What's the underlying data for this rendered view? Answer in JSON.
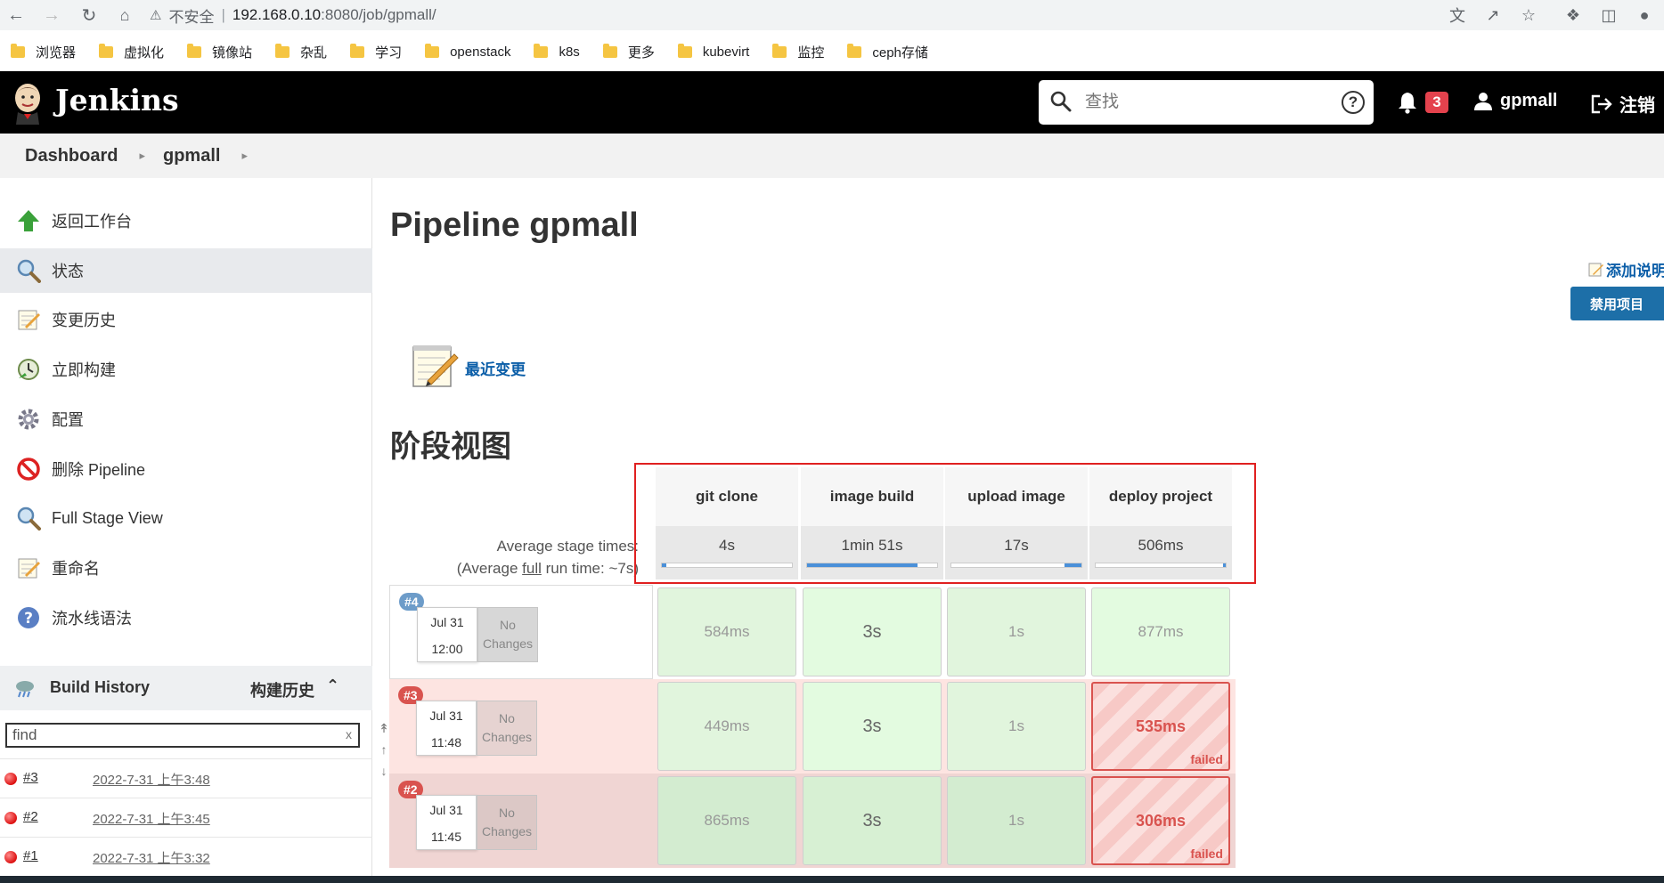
{
  "browser": {
    "insecure_label": "不安全",
    "separator": "|",
    "host": "192.168.0.10",
    "path": ":8080/job/gpmall/",
    "bookmarks": [
      "浏览器",
      "虚拟化",
      "镜像站",
      "杂乱",
      "学习",
      "openstack",
      "k8s",
      "更多",
      "kubevirt",
      "监控",
      "ceph存储"
    ]
  },
  "header": {
    "title": "Jenkins",
    "search_placeholder": "查找",
    "help": "?",
    "notifications": "3",
    "user": "gpmall",
    "logout": "注销"
  },
  "breadcrumb": {
    "items": [
      "Dashboard",
      "gpmall"
    ]
  },
  "sidebar": {
    "tasks": [
      {
        "label": "返回工作台",
        "icon": "up-arrow-icon"
      },
      {
        "label": "状态",
        "icon": "magnifier-icon"
      },
      {
        "label": "变更历史",
        "icon": "notepad-icon"
      },
      {
        "label": "立即构建",
        "icon": "build-clock-icon"
      },
      {
        "label": "配置",
        "icon": "gear-icon"
      },
      {
        "label": "删除 Pipeline",
        "icon": "no-entry-icon"
      },
      {
        "label": "Full Stage View",
        "icon": "magnifier-icon"
      },
      {
        "label": "重命名",
        "icon": "notepad-icon"
      },
      {
        "label": "流水线语法",
        "icon": "help-circle-icon"
      }
    ],
    "build_history": {
      "title": "Build History",
      "title_cn": "构建历史",
      "filter_placeholder": "find",
      "clear": "x",
      "builds": [
        {
          "number": "#3",
          "date": "2022-7-31 上午3:48"
        },
        {
          "number": "#2",
          "date": "2022-7-31 上午3:45"
        },
        {
          "number": "#1",
          "date": "2022-7-31 上午3:32"
        }
      ]
    }
  },
  "main": {
    "title": "Pipeline gpmall",
    "add_description": "添加说明",
    "disable_button": "禁用项目",
    "recent_changes": "最近变更",
    "stage_view_title": "阶段视图"
  },
  "stage_view": {
    "avg_label_line1": "Average stage times:",
    "avg_label_prefix": "(Average ",
    "avg_label_full": "full",
    "avg_label_suffix": " run time: ~7s)",
    "stages": [
      {
        "name": "git clone",
        "avg": "4s",
        "avg_fraction": 0.035
      },
      {
        "name": "image build",
        "avg": "1min 51s",
        "avg_fraction": 0.85
      },
      {
        "name": "upload image",
        "avg": "17s",
        "avg_fraction": 0.13
      },
      {
        "name": "deploy project",
        "avg": "506ms",
        "avg_fraction": 0.005
      }
    ],
    "runs": [
      {
        "badge": "#4",
        "date": "Jul 31",
        "time": "12:00",
        "no_changes": "No Changes",
        "cells": [
          {
            "text": "584ms",
            "status": "success"
          },
          {
            "text": "3s",
            "status": "success"
          },
          {
            "text": "1s",
            "status": "success"
          },
          {
            "text": "877ms",
            "status": "success"
          }
        ]
      },
      {
        "badge": "#3",
        "date": "Jul 31",
        "time": "11:48",
        "no_changes": "No Changes",
        "cells": [
          {
            "text": "449ms",
            "status": "success"
          },
          {
            "text": "3s",
            "status": "success"
          },
          {
            "text": "1s",
            "status": "success"
          },
          {
            "text": "535ms",
            "status": "failed",
            "label": "failed"
          }
        ]
      },
      {
        "badge": "#2",
        "date": "Jul 31",
        "time": "11:45",
        "no_changes": "No Changes",
        "cells": [
          {
            "text": "865ms",
            "status": "success"
          },
          {
            "text": "3s",
            "status": "success"
          },
          {
            "text": "1s",
            "status": "success"
          },
          {
            "text": "306ms",
            "status": "failed",
            "label": "failed"
          }
        ]
      }
    ]
  },
  "colors": {
    "jenkins_header": "#000000",
    "link_blue": "#0b5ea8",
    "success_cell": "#e1f8dd",
    "failed_red": "#d9534f",
    "highlight_red": "#e02020"
  }
}
